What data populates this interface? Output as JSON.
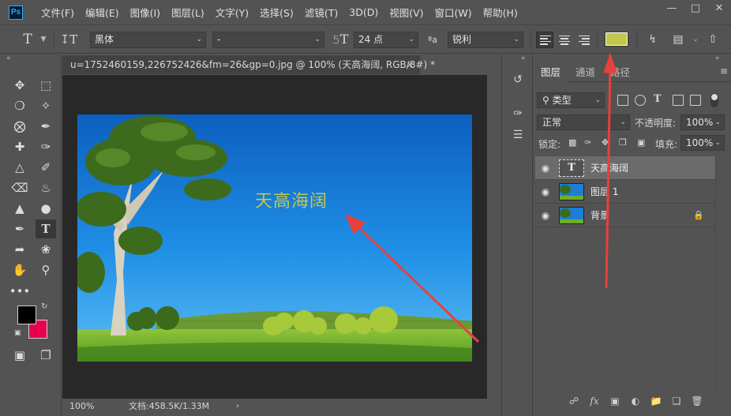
{
  "menubar": {
    "logo": "Ps",
    "items": [
      "文件(F)",
      "编辑(E)",
      "图像(I)",
      "图层(L)",
      "文字(Y)",
      "选择(S)",
      "滤镜(T)",
      "3D(D)",
      "视图(V)",
      "窗口(W)",
      "帮助(H)"
    ],
    "window_controls": [
      "minimize-icon",
      "restore-icon",
      "close-icon"
    ]
  },
  "options_bar": {
    "font_family": "黑体",
    "font_style": "-",
    "font_size": "24 点",
    "antialias": "锐利",
    "text_color": "#c2c84e",
    "tool_icon": "type-tool-icon"
  },
  "document": {
    "tab_title": "u=1752460159,226752426&fm=26&gp=0.jpg @ 100% (天高海阔, RGB/8#) *",
    "canvas_text": "天高海阔",
    "zoom": "100%",
    "doc_info": "文档:458.5K/1.33M"
  },
  "layers_panel": {
    "tabs": [
      "图层",
      "通道",
      "路径"
    ],
    "active_tab": "图层",
    "filter_label": "类型",
    "blend_mode": "正常",
    "opacity_label": "不透明度:",
    "opacity_value": "100%",
    "lock_label": "锁定:",
    "fill_label": "填充:",
    "fill_value": "100%",
    "layers": [
      {
        "name": "天高海阔",
        "kind": "text",
        "selected": true,
        "visible": true,
        "locked": false
      },
      {
        "name": "图层 1",
        "kind": "image",
        "selected": false,
        "visible": true,
        "locked": false
      },
      {
        "name": "背景",
        "kind": "image",
        "selected": false,
        "visible": true,
        "locked": true
      }
    ]
  },
  "colors": {
    "foreground": "#000000",
    "background": "#e8004f",
    "annotation_arrow": "#e8403c"
  }
}
